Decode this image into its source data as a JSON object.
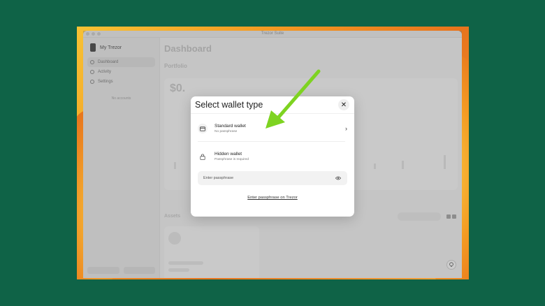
{
  "window": {
    "title": "Trezor Suite"
  },
  "sidebar": {
    "device_name": "My Trezor",
    "items": [
      {
        "label": "Dashboard"
      },
      {
        "label": "Activity"
      },
      {
        "label": "Settings"
      }
    ],
    "empty_text": "No accounts"
  },
  "main": {
    "title": "Dashboard",
    "portfolio_label": "Portfolio",
    "balance": "$0.",
    "assets_label": "Assets",
    "enable_label": "Enable more coins"
  },
  "modal": {
    "title": "Select wallet type",
    "close_glyph": "✕",
    "standard": {
      "title": "Standard wallet",
      "subtitle": "No passphrase",
      "chevron": "›"
    },
    "hidden": {
      "title": "Hidden wallet",
      "subtitle": "Passphrase is required"
    },
    "passphrase_placeholder": "Enter passphrase",
    "trezor_link": "Enter passphrase on Trezor"
  },
  "annotation": {
    "arrow_color": "#7ed321"
  }
}
